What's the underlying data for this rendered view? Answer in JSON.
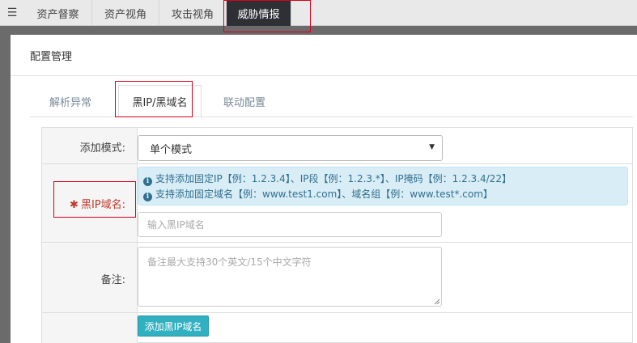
{
  "topnav": {
    "menu_icon": "hamburger-icon",
    "tabs": [
      {
        "label": "资产督察"
      },
      {
        "label": "资产视角"
      },
      {
        "label": "攻击视角"
      },
      {
        "label": "威胁情报",
        "active": true
      }
    ]
  },
  "modal": {
    "title": "配置管理",
    "tabs": [
      {
        "label": "解析异常"
      },
      {
        "label": "黑IP/黑域名",
        "active": true
      },
      {
        "label": "联动配置"
      }
    ]
  },
  "form": {
    "mode_label": "添加模式:",
    "mode_value": "单个模式",
    "blacklist_label": "黑IP域名:",
    "required_mark": "✱",
    "hint_ip": "支持添加固定IP【例：1.2.3.4】、IP段【例：1.2.3.*】、IP掩码【例：1.2.3.4/22】",
    "hint_domain": "支持添加固定域名【例：www.test1.com】、域名组【例：www.test*.com】",
    "blacklist_placeholder": "输入黑IP域名",
    "note_label": "备注:",
    "note_placeholder": "备注最大支持30个英文/15个中文字符",
    "submit_label": "添加黑IP域名"
  },
  "colors": {
    "nav_active_bg": "#2d3035",
    "highlight_box": "#d9001b",
    "button_bg": "#30b0c0",
    "alert_bg": "#d9edf7",
    "required_text": "#c0392b"
  }
}
